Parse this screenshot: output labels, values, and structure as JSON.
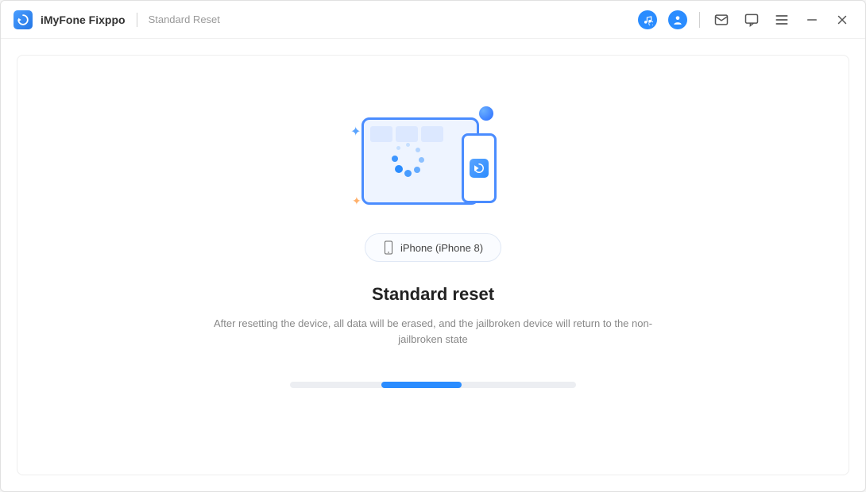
{
  "titlebar": {
    "app_name": "iMyFone Fixppo",
    "breadcrumb": "Standard Reset"
  },
  "main": {
    "device_label": "iPhone (iPhone 8)",
    "heading": "Standard reset",
    "description": "After resetting the device, all data will be erased, and the jailbroken device will return to the non-jailbroken state"
  }
}
